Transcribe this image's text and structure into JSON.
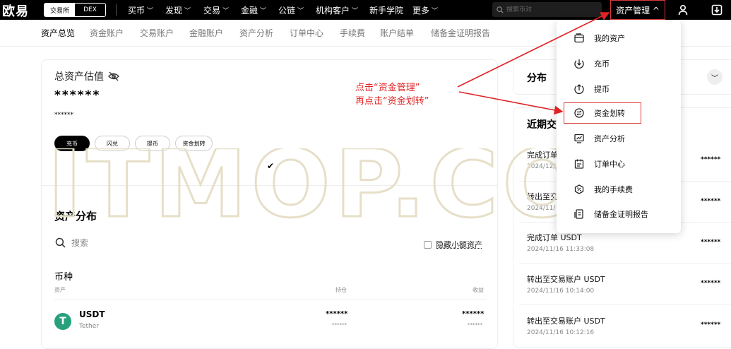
{
  "topbar": {
    "logo": "欧易",
    "modes": [
      "交易所",
      "DEX"
    ],
    "nav": [
      {
        "label": "买币",
        "chev": true
      },
      {
        "label": "发现",
        "chev": true
      },
      {
        "label": "交易",
        "chev": true
      },
      {
        "label": "金融",
        "chev": true
      },
      {
        "label": "公链",
        "chev": true
      },
      {
        "label": "机构客户",
        "chev": true
      },
      {
        "label": "新手学院",
        "chev": false
      },
      {
        "label": "更多",
        "chev": true
      }
    ],
    "search_placeholder": "搜索币对",
    "asset_mgmt": "资产管理 ^"
  },
  "subtabs": [
    "资产总览",
    "资金账户",
    "交易账户",
    "金融账户",
    "资产分析",
    "订单中心",
    "手续费",
    "账户结单",
    "储备金证明报告"
  ],
  "overview": {
    "title": "总资产估值",
    "value": "******",
    "sub_value": "******",
    "actions": [
      "充币",
      "闪兑",
      "提币",
      "资金划转"
    ],
    "check": "✔"
  },
  "distribution": {
    "title": "资产分布",
    "search_placeholder": "搜索",
    "hide_small": "隐藏小额资产",
    "coin_header": "币种",
    "columns": [
      "资产",
      "持仓",
      "收益"
    ],
    "rows": [
      {
        "symbol": "USDT",
        "name": "Tether",
        "holding": "******",
        "holding_sub": "******",
        "earnings": "******",
        "earnings_sub": "******"
      }
    ]
  },
  "right": {
    "dist_title": "分布",
    "recent_title": "近期交",
    "transactions": [
      {
        "title": "完成订单",
        "time": "2024/12/",
        "amount": "******"
      },
      {
        "title": "转出至交",
        "time": "2024/11/",
        "amount": "******"
      },
      {
        "title": "完成订单 USDT",
        "time": "2024/11/16 11:33:08",
        "amount": "******"
      },
      {
        "title": "转出至交易账户 USDT",
        "time": "2024/11/16 10:14:00",
        "amount": "******"
      },
      {
        "title": "转出至交易账户 USDT",
        "time": "2024/11/16 10:12:16",
        "amount": "******"
      }
    ]
  },
  "dropdown": {
    "items": [
      {
        "label": "我的资产",
        "icon": "wallet-icon"
      },
      {
        "label": "充币",
        "icon": "deposit-icon"
      },
      {
        "label": "提币",
        "icon": "withdraw-icon"
      },
      {
        "label": "资金划转",
        "icon": "transfer-icon"
      },
      {
        "label": "资产分析",
        "icon": "analysis-icon"
      },
      {
        "label": "订单中心",
        "icon": "order-icon"
      },
      {
        "label": "我的手续费",
        "icon": "fee-icon"
      },
      {
        "label": "储备金证明报告",
        "icon": "report-icon"
      }
    ]
  },
  "annotation": {
    "line1": "点击“资金管理”",
    "line2": "再点击“资金划转”"
  },
  "watermark": "ITMOP.COM",
  "colors": {
    "accent_red": "#e02424",
    "usdt_green": "#26a17b"
  }
}
